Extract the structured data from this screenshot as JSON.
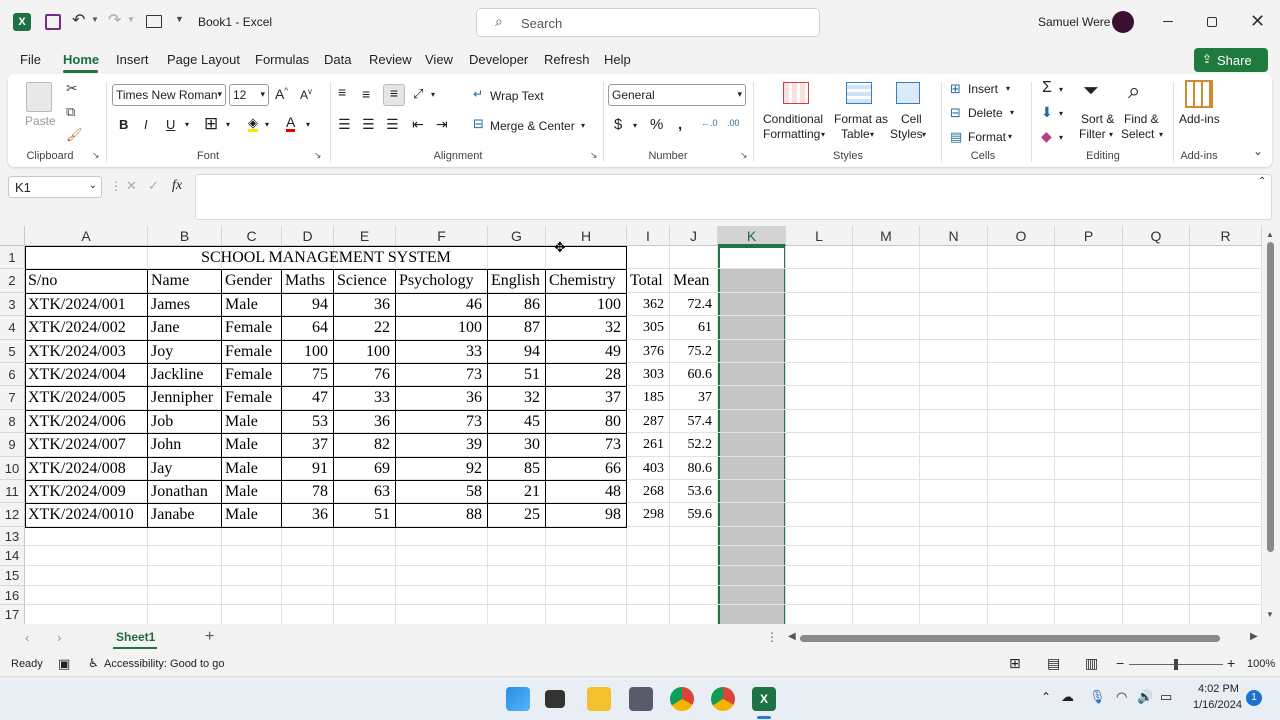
{
  "window": {
    "title": "Book1 - Excel",
    "search_placeholder": "Search",
    "user": "Samuel Were"
  },
  "menu": [
    "File",
    "Home",
    "Insert",
    "Page Layout",
    "Formulas",
    "Data",
    "Review",
    "View",
    "Developer",
    "Refresh",
    "Help"
  ],
  "share_label": "Share",
  "ribbon": {
    "paste": "Paste",
    "clipboard": "Clipboard",
    "font_name": "Times New Roman",
    "font_size": "12",
    "font": "Font",
    "wrap_text": "Wrap Text",
    "merge_center": "Merge & Center",
    "alignment": "Alignment",
    "number_format": "General",
    "number": "Number",
    "cond_fmt_1": "Conditional",
    "cond_fmt_2": "Formatting",
    "fmt_table_1": "Format as",
    "fmt_table_2": "Table",
    "cell_styles_1": "Cell",
    "cell_styles_2": "Styles",
    "styles": "Styles",
    "insert": "Insert",
    "delete": "Delete",
    "format": "Format",
    "cells": "Cells",
    "sort_1": "Sort &",
    "sort_2": "Filter",
    "find_1": "Find &",
    "find_2": "Select",
    "editing": "Editing",
    "addins": "Add-ins",
    "addins_group": "Add-ins"
  },
  "formula_bar": {
    "name_box": "K1",
    "fx": "fx",
    "content": ""
  },
  "columns": [
    "A",
    "B",
    "C",
    "D",
    "E",
    "F",
    "G",
    "H",
    "I",
    "J",
    "K",
    "L",
    "M",
    "N",
    "O",
    "P",
    "Q",
    "R"
  ],
  "rows": [
    "1",
    "2",
    "3",
    "4",
    "5",
    "6",
    "7",
    "8",
    "9",
    "10",
    "11",
    "12",
    "13",
    "14",
    "15",
    "16",
    "17"
  ],
  "sheet": {
    "title": "SCHOOL MANAGEMENT SYSTEM",
    "headers": [
      "S/no",
      "Name",
      "Gender",
      "Maths",
      "Science",
      "Psychology",
      "English",
      "Chemistry",
      "Total",
      "Mean"
    ],
    "records": [
      [
        "XTK/2024/001",
        "James",
        "Male",
        "94",
        "36",
        "46",
        "86",
        "100",
        "362",
        "72.4"
      ],
      [
        "XTK/2024/002",
        "Jane",
        "Female",
        "64",
        "22",
        "100",
        "87",
        "32",
        "305",
        "61"
      ],
      [
        "XTK/2024/003",
        "Joy",
        "Female",
        "100",
        "100",
        "33",
        "94",
        "49",
        "376",
        "75.2"
      ],
      [
        "XTK/2024/004",
        "Jackline",
        "Female",
        "75",
        "76",
        "73",
        "51",
        "28",
        "303",
        "60.6"
      ],
      [
        "XTK/2024/005",
        "Jennipher",
        "Female",
        "47",
        "33",
        "36",
        "32",
        "37",
        "185",
        "37"
      ],
      [
        "XTK/2024/006",
        "Job",
        "Male",
        "53",
        "36",
        "73",
        "45",
        "80",
        "287",
        "57.4"
      ],
      [
        "XTK/2024/007",
        "John",
        "Male",
        "37",
        "82",
        "39",
        "30",
        "73",
        "261",
        "52.2"
      ],
      [
        "XTK/2024/008",
        "Jay",
        "Male",
        "91",
        "69",
        "92",
        "85",
        "66",
        "403",
        "80.6"
      ],
      [
        "XTK/2024/009",
        "Jonathan",
        "Male",
        "78",
        "63",
        "58",
        "21",
        "48",
        "268",
        "53.6"
      ],
      [
        "XTK/2024/0010",
        "Janabe",
        "Male",
        "36",
        "51",
        "88",
        "25",
        "98",
        "298",
        "59.6"
      ]
    ]
  },
  "sheet_tab": "Sheet1",
  "status": {
    "ready": "Ready",
    "accessibility": "Accessibility: Good to go",
    "zoom": "100%"
  },
  "taskbar": {
    "time": "4:02 PM",
    "date": "1/16/2024",
    "notifications": "1"
  },
  "colors": {
    "excel_green": "#217346",
    "selection": "#c6c6c6",
    "share_bg": "#1f7a3e"
  }
}
